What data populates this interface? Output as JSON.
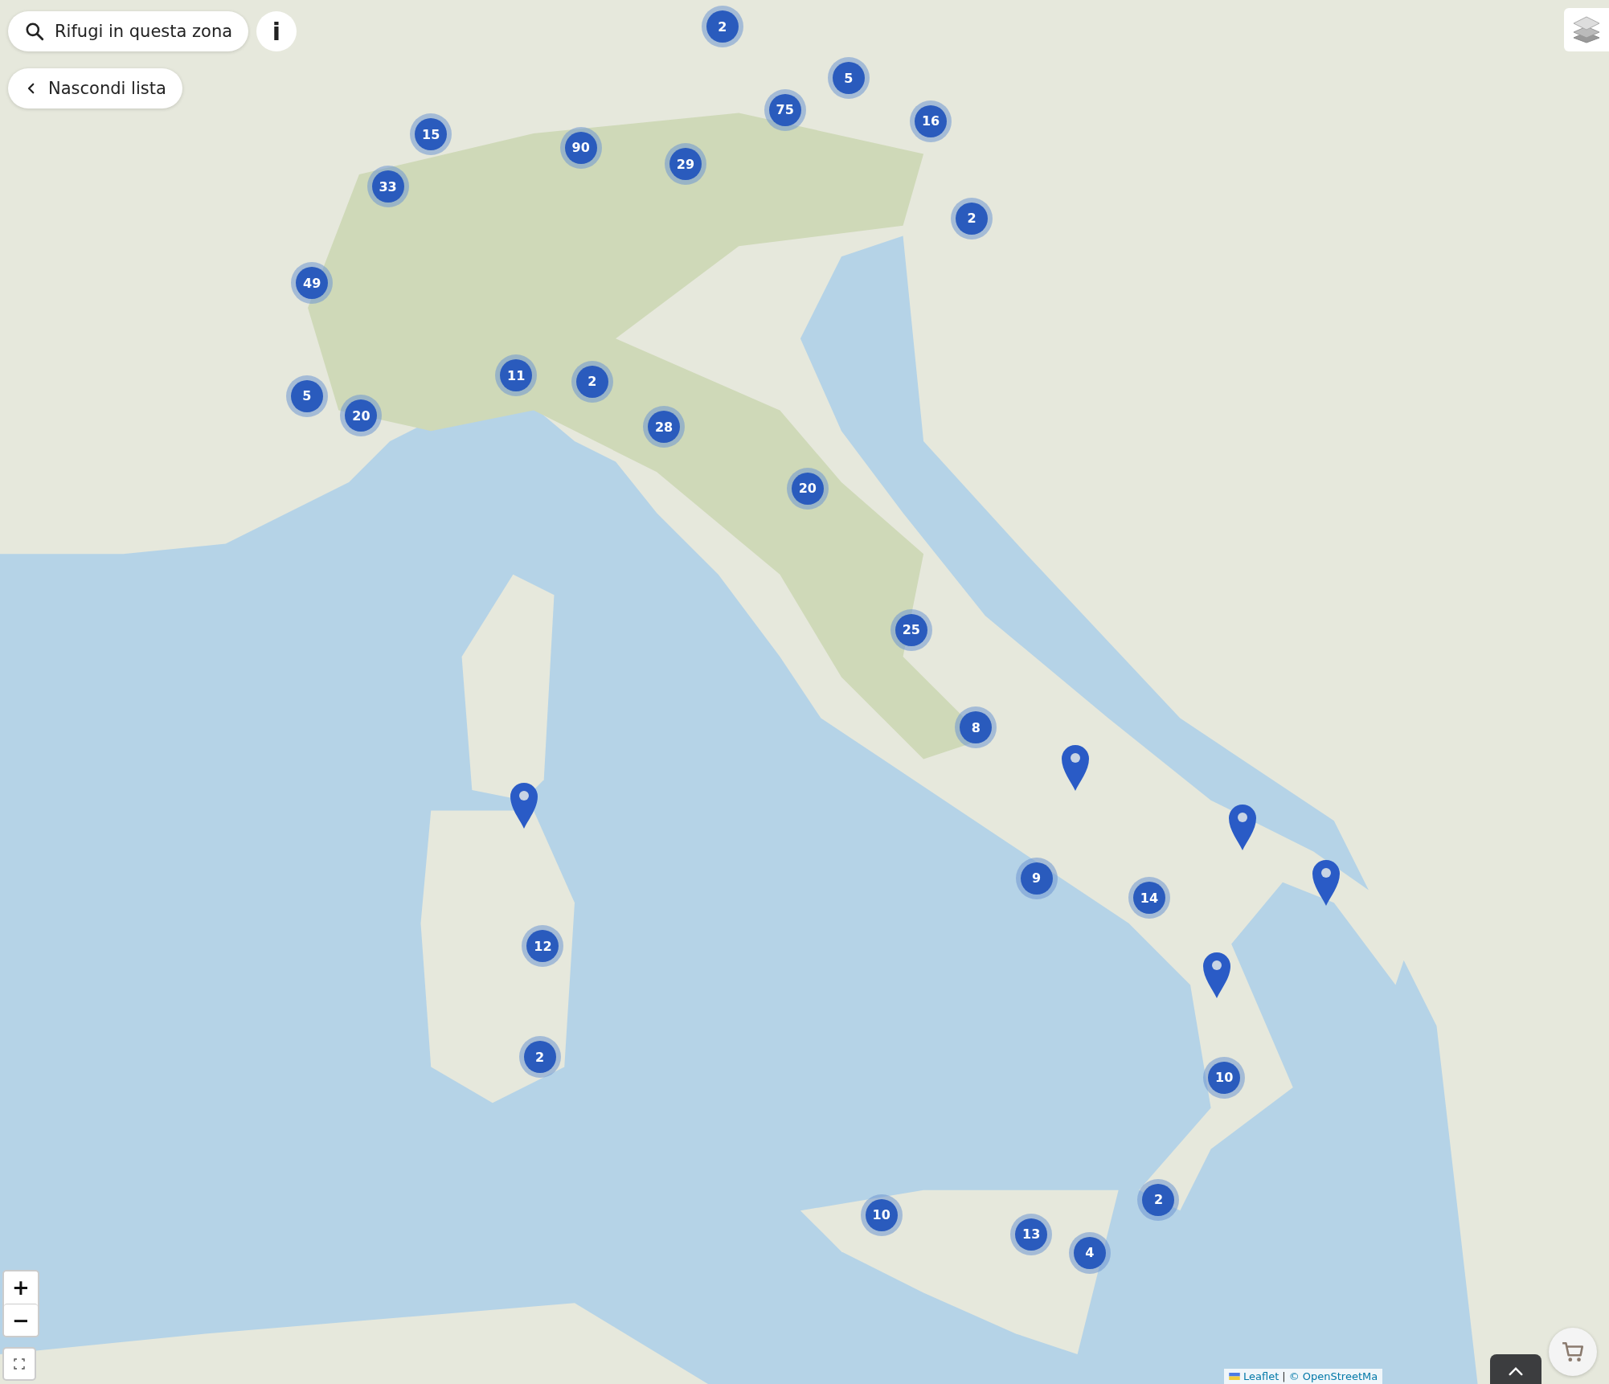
{
  "search_button": {
    "label": "Rifugi in questa zona"
  },
  "info_button": {
    "label": "i"
  },
  "list_toggle": {
    "label": "Nascondi lista"
  },
  "zoom": {
    "zoom_in": "+",
    "zoom_out": "−"
  },
  "clusters": [
    {
      "count": "2"
    },
    {
      "count": "5"
    },
    {
      "count": "75"
    },
    {
      "count": "16"
    },
    {
      "count": "15"
    },
    {
      "count": "90"
    },
    {
      "count": "29"
    },
    {
      "count": "33"
    },
    {
      "count": "2"
    },
    {
      "count": "49"
    },
    {
      "count": "11"
    },
    {
      "count": "2"
    },
    {
      "count": "5"
    },
    {
      "count": "20"
    },
    {
      "count": "28"
    },
    {
      "count": "20"
    },
    {
      "count": "25"
    },
    {
      "count": "8"
    },
    {
      "count": "9"
    },
    {
      "count": "14"
    },
    {
      "count": "12"
    },
    {
      "count": "2"
    },
    {
      "count": "10"
    },
    {
      "count": "2"
    },
    {
      "count": "10"
    },
    {
      "count": "13"
    },
    {
      "count": "4"
    }
  ],
  "attribution": {
    "leaflet": "Leaflet",
    "separator": "|",
    "osm": "© OpenStreetMa"
  }
}
